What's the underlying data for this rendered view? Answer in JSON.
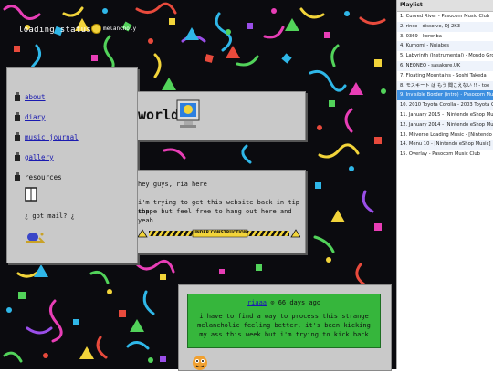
{
  "status": {
    "label": "loading status :",
    "mood": "melancholy"
  },
  "nav": {
    "items": [
      {
        "label": "about",
        "link": true
      },
      {
        "label": "diary",
        "link": true
      },
      {
        "label": "music journal",
        "link": true
      },
      {
        "label": "gallery",
        "link": true
      },
      {
        "label": "resources",
        "link": false
      }
    ],
    "mail": "¿ got mail? ¿"
  },
  "title": {
    "text": "world"
  },
  "intro": {
    "line1": "hey guys, ria here",
    "line2": "i'm trying to get this website back in tip top",
    "line3": "shape but feel free to hang out here and yeah",
    "construction": "UNDER CONSTRUCTION"
  },
  "post": {
    "author": "riaaa",
    "time": "66 days ago",
    "body": "i have to find a way to process this strange melancholic feeling better, it's been kicking my ass this week but i'm trying to kick back"
  },
  "playlist": {
    "header": "Playlist",
    "active_index": 8,
    "tracks": [
      "1. Curved River - Pasocom Music Club",
      "2. rinse - dissolve, DJ 2K3",
      "3. 0369 - koronba",
      "4. Kumomi - Nujabes",
      "5. Labyrinth (Instrumental) - Mondo Grosso",
      "6. NEONEO - sasakure.UK",
      "7. Floating Mountains - Soshi Takeda",
      "8. モスキート は もう 聞こえない !! - toe",
      "9. Invisible Border (intro) - Pasocom Music Club",
      "10. 2010 Toyota Corolla - 2003 Toyota Corolla",
      "11. January 2015 - [Nintendo eShop Music]",
      "12. January 2014 - [Nintendo eShop Music]",
      "13. Miiverse Loading Music - [Nintendo 3DS]",
      "14. Menu 10 - [Nintendo eShop Music]",
      "15. Overlay - Pasocom Music Club"
    ]
  }
}
